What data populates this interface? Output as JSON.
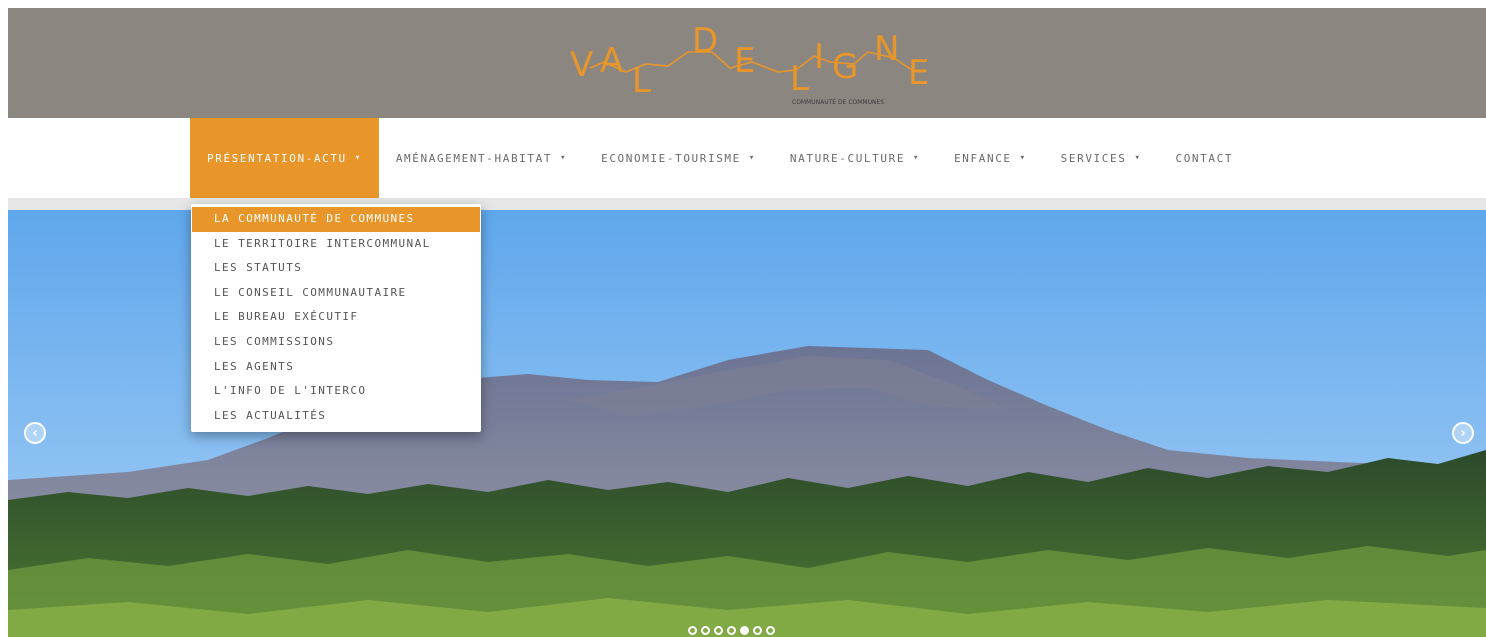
{
  "logo": {
    "letters": [
      "V",
      "A",
      "L",
      "D",
      "E",
      "L",
      "I",
      "G",
      "N",
      "E"
    ],
    "tagline": "COMMUNAUTÉ DE COMMUNES",
    "color": "#e8962a"
  },
  "nav": {
    "items": [
      {
        "label": "PRÉSENTATION-ACTU",
        "caret": "▾"
      },
      {
        "label": "AMÉNAGEMENT-HABITAT",
        "caret": "▾"
      },
      {
        "label": "ECONOMIE-TOURISME",
        "caret": "▾"
      },
      {
        "label": "NATURE-CULTURE",
        "caret": "▾"
      },
      {
        "label": "ENFANCE",
        "caret": "▾"
      },
      {
        "label": "SERVICES",
        "caret": "▾"
      },
      {
        "label": "CONTACT"
      }
    ]
  },
  "dropdown": {
    "items": [
      "LA COMMUNAUTÉ DE COMMUNES",
      "LE TERRITOIRE INTERCOMMUNAL",
      "LES STATUTS",
      "LE CONSEIL COMMUNAUTAIRE",
      "LE BUREAU EXÉCUTIF",
      "LES COMMISSIONS",
      "LES AGENTS",
      "L'INFO DE L'INTERCO",
      "LES ACTUALITÉS"
    ]
  },
  "slider": {
    "prev_icon": "chevron-left-icon",
    "next_icon": "chevron-right-icon",
    "prev_glyph": "‹",
    "next_glyph": "›",
    "slide_count": 7,
    "active_slide": 5
  },
  "colors": {
    "accent": "#e8962a",
    "header_bg": "#8c8680"
  }
}
